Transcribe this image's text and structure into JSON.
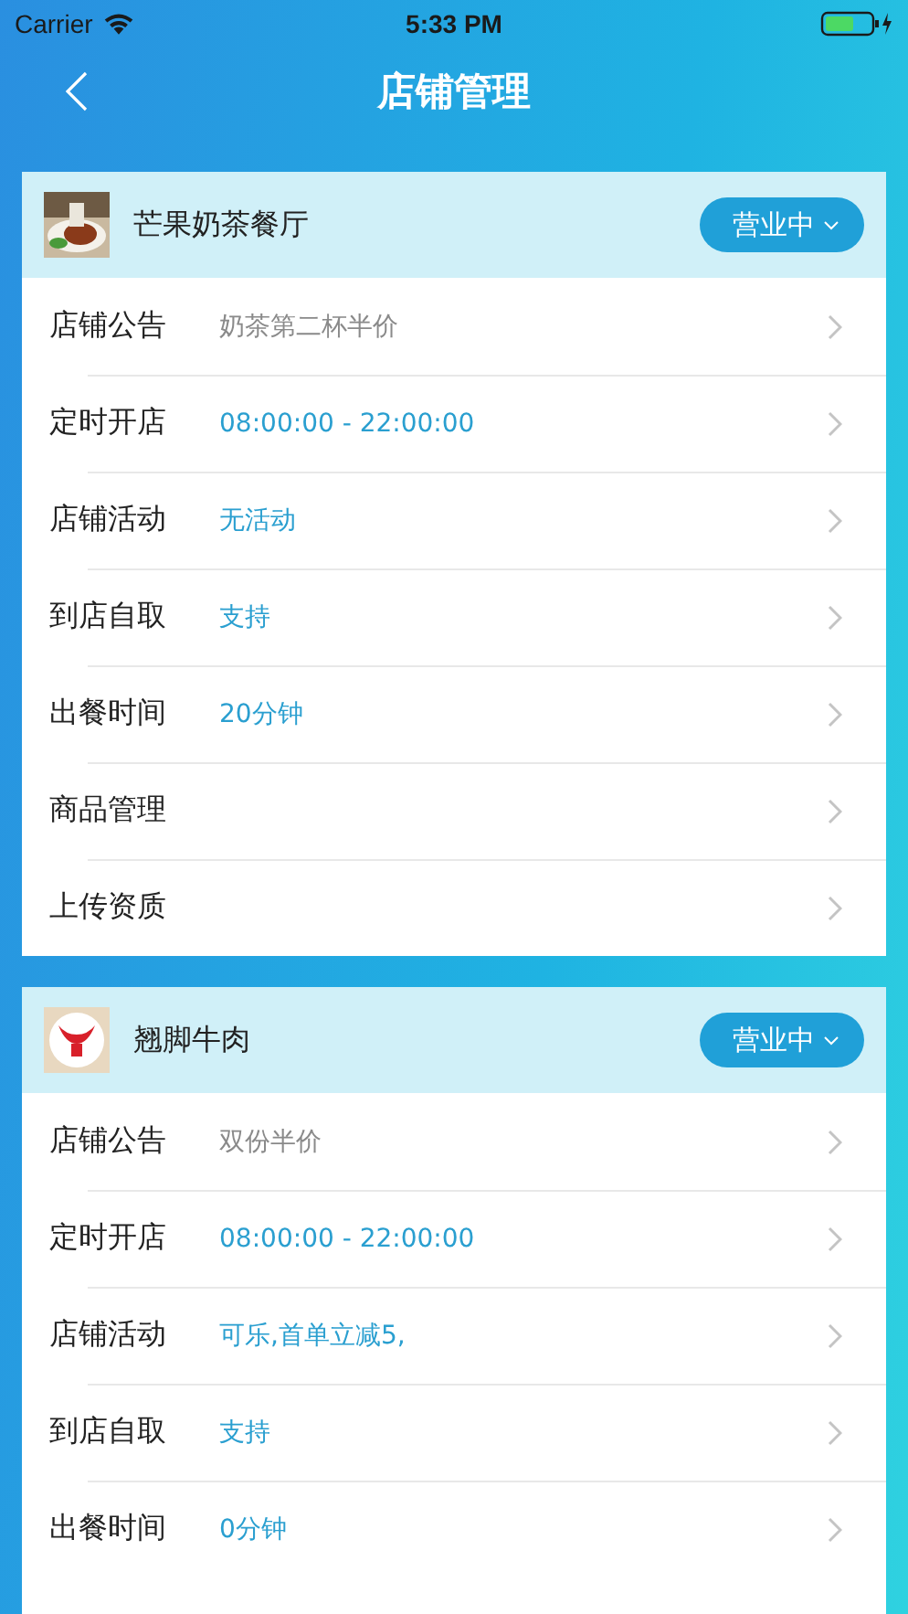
{
  "status_bar": {
    "carrier": "Carrier",
    "time": "5:33 PM"
  },
  "nav": {
    "title": "店铺管理"
  },
  "stores": [
    {
      "name": "芒果奶茶餐厅",
      "status": "营业中",
      "rows": [
        {
          "label": "店铺公告",
          "value": "奶茶第二杯半价",
          "kind": "notice"
        },
        {
          "label": "定时开店",
          "value": "08:00:00 - 22:00:00",
          "kind": "setting"
        },
        {
          "label": "店铺活动",
          "value": "无活动",
          "kind": "setting"
        },
        {
          "label": "到店自取",
          "value": "支持",
          "kind": "setting"
        },
        {
          "label": "出餐时间",
          "value": "20分钟",
          "kind": "setting"
        },
        {
          "label": "商品管理"
        },
        {
          "label": "上传资质"
        }
      ]
    },
    {
      "name": "翘脚牛肉",
      "status": "营业中",
      "rows": [
        {
          "label": "店铺公告",
          "value": "双份半价",
          "kind": "notice"
        },
        {
          "label": "定时开店",
          "value": "08:00:00 - 22:00:00",
          "kind": "setting"
        },
        {
          "label": "店铺活动",
          "value": "可乐,首单立减5,",
          "kind": "setting"
        },
        {
          "label": "到店自取",
          "value": "支持",
          "kind": "setting"
        },
        {
          "label": "出餐时间",
          "value": "0分钟",
          "kind": "setting"
        }
      ]
    }
  ]
}
